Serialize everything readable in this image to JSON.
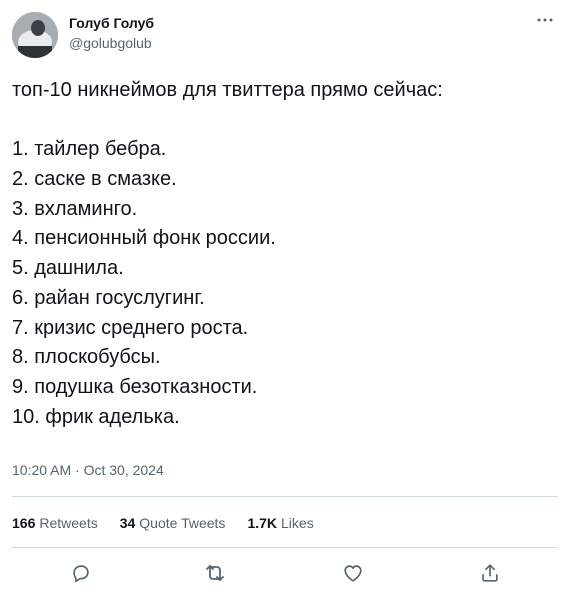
{
  "author": {
    "display_name": "Голуб Голуб",
    "handle": "@golubgolub"
  },
  "tweet": {
    "lines": [
      "топ-10 никнеймов для твиттера прямо сейчас:",
      "",
      "1. тайлер бебра.",
      "2. саске в смазке.",
      "3. вхламинго.",
      "4. пенсионный фонк россии.",
      "5. дашнила.",
      "6. райан госуслугинг.",
      "7. кризис среднего роста.",
      "8. плоскобубсы.",
      "9. подушка безотказности.",
      "10. фрик аделька."
    ],
    "timestamp": "10:20 AM · Oct 30, 2024"
  },
  "stats": {
    "retweets_count": "166",
    "retweets_label": "Retweets",
    "quotes_count": "34",
    "quotes_label": "Quote Tweets",
    "likes_count": "1.7K",
    "likes_label": "Likes"
  },
  "icons": {
    "more": "more-dots-icon",
    "reply": "reply-bubble-icon",
    "retweet": "retweet-icon",
    "like": "heart-icon",
    "share": "share-upload-icon"
  },
  "colors": {
    "text": "#0f1419",
    "secondary": "#536471",
    "divider": "#cfd9de"
  }
}
